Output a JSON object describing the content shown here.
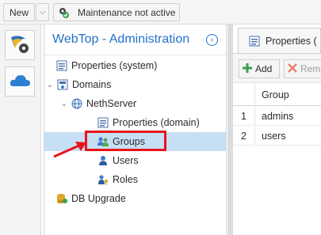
{
  "topbar": {
    "new_label": "New",
    "caret": "⌵",
    "maintenance_label": "Maintenance not active"
  },
  "panel": {
    "title": "WebTop - Administration",
    "collapse_icon": "‹"
  },
  "tree": [
    {
      "label": "Properties (system)",
      "icon": "properties-icon"
    },
    {
      "label": "Domains",
      "icon": "domains-icon"
    },
    {
      "label": "NethServer",
      "icon": "globe-icon"
    },
    {
      "label": "Properties (domain)",
      "icon": "properties-icon"
    },
    {
      "label": "Groups",
      "icon": "groups-icon",
      "selected": true
    },
    {
      "label": "Users",
      "icon": "user-icon"
    },
    {
      "label": "Roles",
      "icon": "roles-icon"
    },
    {
      "label": "DB Upgrade",
      "icon": "db-upgrade-icon"
    }
  ],
  "right": {
    "tab_label": "Properties (",
    "add_label": "Add",
    "remove_label": "Rem",
    "column_group": "Group",
    "rows": [
      {
        "num": "1",
        "group": "admins"
      },
      {
        "num": "2",
        "group": "users"
      }
    ]
  },
  "colors": {
    "accent": "#2472c8",
    "selection": "#c6dff5",
    "annotation": "#e8141c"
  }
}
